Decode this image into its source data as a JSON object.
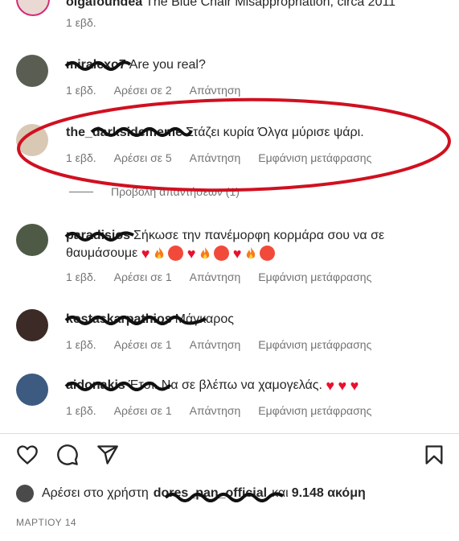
{
  "top_comment": {
    "username": "olgafoundea",
    "text": "The Blue Chair Misappropriation, circa 2011",
    "time": "1 εβδ."
  },
  "comments": [
    {
      "username": "miralexo7",
      "text": "Are you real?",
      "time": "1 εβδ.",
      "likes": "Αρέσει σε 2",
      "reply": "Απάντηση"
    },
    {
      "username": "the_darksidememe",
      "text": "Στάζει κυρία Όλγα μύρισε ψάρι.",
      "time": "1 εβδ.",
      "likes": "Αρέσει σε 5",
      "reply": "Απάντηση",
      "translate": "Εμφάνιση μετάφρασης",
      "view_replies": "Προβολή απαντήσεων (1)"
    },
    {
      "username": "paradisios",
      "text": "Σήκωσε την πανέμορφη κορμάρα σου να σε θαυμάσουμε",
      "time": "1 εβδ.",
      "likes": "Αρέσει σε 1",
      "reply": "Απάντηση",
      "translate": "Εμφάνιση μετάφρασης"
    },
    {
      "username": "kostaskarpathios",
      "text": "Μάγκαρος",
      "time": "1 εβδ.",
      "likes": "Αρέσει σε 1",
      "reply": "Απάντηση",
      "translate": "Εμφάνιση μετάφρασης"
    },
    {
      "username": "aidonakis",
      "text": "Έτσι. Να σε βλέπω να χαμογελάς.",
      "time": "1 εβδ.",
      "likes": "Αρέσει σε 1",
      "reply": "Απάντηση",
      "translate": "Εμφάνιση μετάφρασης"
    }
  ],
  "likes_bar": {
    "prefix": "Αρέσει στο χρήστη",
    "user": "dores_pan_official",
    "middle": "και",
    "count": "9.148 ακόμη"
  },
  "date": "ΜΑΡΤΙΟΥ 14",
  "icons": [
    "heart-icon",
    "comment-icon",
    "share-icon",
    "bookmark-icon"
  ],
  "colors": {
    "annotation": "#d01020",
    "heart_emoji": "#e8112d",
    "meta": "#737373"
  }
}
